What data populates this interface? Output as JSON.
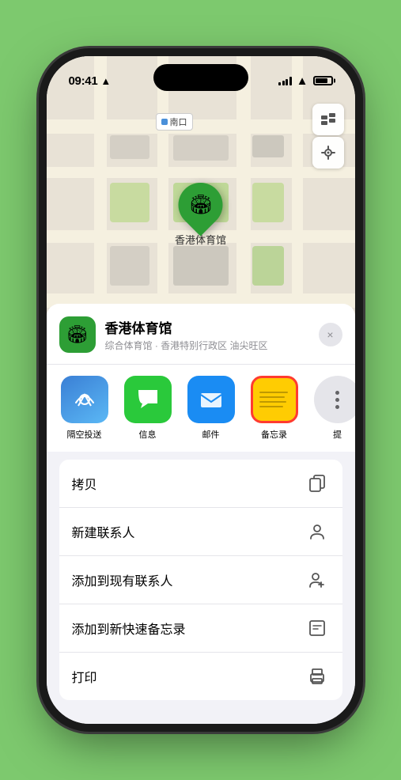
{
  "status_bar": {
    "time": "09:41",
    "location_arrow": "▶"
  },
  "map": {
    "label_text": "南口"
  },
  "place": {
    "name": "香港体育馆",
    "subtitle": "综合体育馆 · 香港特别行政区 油尖旺区",
    "pin_emoji": "🏟"
  },
  "share_actions": [
    {
      "id": "airdrop",
      "label": "隔空投送",
      "emoji": "📶"
    },
    {
      "id": "message",
      "label": "信息",
      "emoji": "💬"
    },
    {
      "id": "mail",
      "label": "邮件",
      "emoji": "✉"
    },
    {
      "id": "notes",
      "label": "备忘录",
      "emoji": ""
    },
    {
      "id": "more",
      "label": "提",
      "emoji": ""
    }
  ],
  "actions": [
    {
      "id": "copy",
      "label": "拷贝",
      "icon": "📋"
    },
    {
      "id": "new-contact",
      "label": "新建联系人",
      "icon": "👤"
    },
    {
      "id": "add-contact",
      "label": "添加到现有联系人",
      "icon": "👤"
    },
    {
      "id": "add-notes",
      "label": "添加到新快速备忘录",
      "icon": "📝"
    },
    {
      "id": "print",
      "label": "打印",
      "icon": "🖨"
    }
  ],
  "close_label": "×"
}
